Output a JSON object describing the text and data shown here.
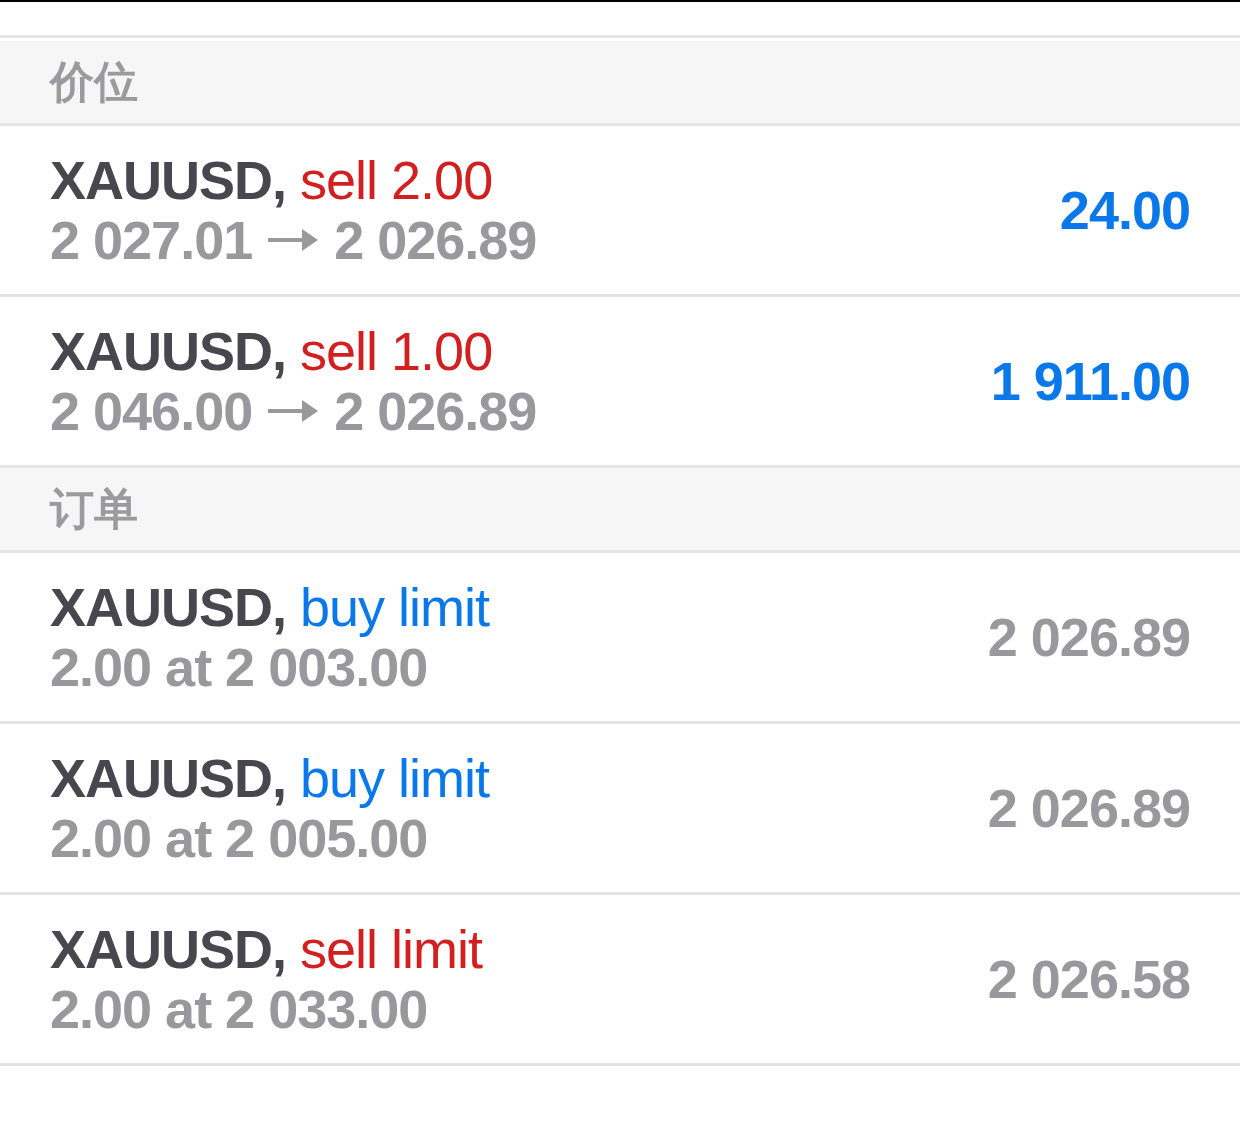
{
  "sections": [
    {
      "title": "价位",
      "items": [
        {
          "kind": "position",
          "symbol": "XAUUSD,",
          "color": "#d21f1f",
          "action": "sell 2.00",
          "from": "2 027.01",
          "to": "2 026.89",
          "value": "24.00"
        },
        {
          "kind": "position",
          "symbol": "XAUUSD,",
          "color": "#d21f1f",
          "action": "sell 1.00",
          "from": "2 046.00",
          "to": "2 026.89",
          "value": "1 911.00"
        }
      ]
    },
    {
      "title": "订单",
      "items": [
        {
          "kind": "order",
          "symbol": "XAUUSD,",
          "color": "#0a78e8",
          "action": "buy limit",
          "detail": "2.00 at 2 003.00",
          "value": "2 026.89"
        },
        {
          "kind": "order",
          "symbol": "XAUUSD,",
          "color": "#0a78e8",
          "action": "buy limit",
          "detail": "2.00 at 2 005.00",
          "value": "2 026.89"
        },
        {
          "kind": "order",
          "symbol": "XAUUSD,",
          "color": "#d21f1f",
          "action": "sell limit",
          "detail": "2.00 at 2 033.00",
          "value": "2 026.58"
        }
      ]
    }
  ]
}
